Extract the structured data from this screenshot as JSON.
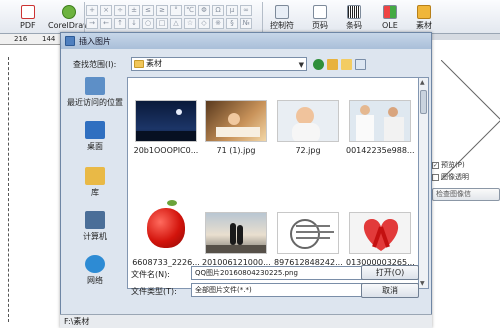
{
  "toolbar": {
    "pdf_label": "PDF",
    "coreldraw_label": "CorelDraw",
    "control_label": "控制符",
    "page_label": "页码",
    "barcode_label": "条码",
    "ole_label": "OLE",
    "material_label": "素材"
  },
  "ruler": {
    "left_num": "216",
    "right_num": "144"
  },
  "dialog": {
    "title": "插入图片",
    "lookin_label": "查找范围(I):",
    "lookin_value": "素材",
    "places": [
      {
        "label": "最近访问的位置",
        "icon": "recent-places-icon",
        "color": "#5d8fc7"
      },
      {
        "label": "桌面",
        "icon": "desktop-icon",
        "color": "#2f6fc0"
      },
      {
        "label": "库",
        "icon": "library-icon",
        "color": "#e9b946"
      },
      {
        "label": "计算机",
        "icon": "computer-icon",
        "color": "#4a6e98"
      },
      {
        "label": "网络",
        "icon": "network-icon",
        "color": "#2d8bd4"
      }
    ],
    "files": [
      {
        "name": "20b1OOOPIC0...",
        "thumb": "night-sky-thumbnail"
      },
      {
        "name": "71 (1).jpg",
        "thumb": "child-reading-thumbnail"
      },
      {
        "name": "72.jpg",
        "thumb": "baby-thumbnail"
      },
      {
        "name": "00142235e988...",
        "thumb": "doctors-thumbnail"
      },
      {
        "name": "6608733_2226...",
        "thumb": "red-apple-thumbnail"
      },
      {
        "name": "201006121000...",
        "thumb": "couple-sunset-thumbnail"
      },
      {
        "name": "897612848242...",
        "thumb": "postmark-thumbnail"
      },
      {
        "name": "013000003265...",
        "thumb": "red-ribbon-thumbnail"
      }
    ],
    "filename_label": "文件名(N):",
    "filename_value": "QQ图片20160804230225.png",
    "filetype_label": "文件类型(T):",
    "filetype_value": "全部图片文件(*.*)",
    "open_button": "打开(O)",
    "cancel_button": "取消",
    "status_path": "F:\\素材"
  },
  "side": {
    "preview_label": "预览(P)",
    "transparent_label": "图像透明",
    "check_button": "检查图像信"
  }
}
